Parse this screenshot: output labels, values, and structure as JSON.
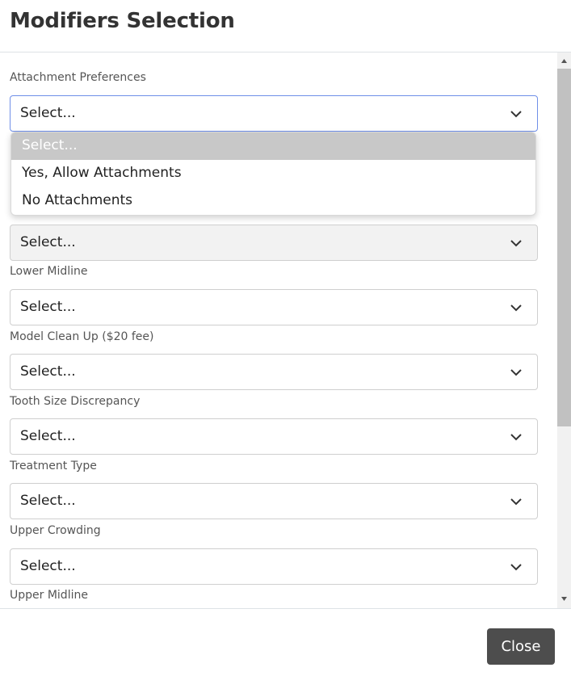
{
  "modal": {
    "title": "Modifiers Selection",
    "close_label": "Close"
  },
  "fields": [
    {
      "label": "Attachment Preferences",
      "value": "Select..."
    },
    {
      "label": "",
      "value": "Select..."
    },
    {
      "label": "Lower Midline",
      "value": "Select..."
    },
    {
      "label": "Model Clean Up ($20 fee)",
      "value": "Select..."
    },
    {
      "label": "Tooth Size Discrepancy",
      "value": "Select..."
    },
    {
      "label": "Treatment Type",
      "value": "Select..."
    },
    {
      "label": "Upper Crowding",
      "value": "Select..."
    },
    {
      "label": "Upper Midline",
      "value": ""
    }
  ],
  "dropdown": {
    "options": [
      "Select...",
      "Yes, Allow Attachments",
      "No Attachments"
    ],
    "selected_index": 0
  },
  "icons": {
    "select_chevron": "chevron-down-icon",
    "scroll_up": "scroll-up-arrow-icon",
    "scroll_down": "scroll-down-arrow-icon"
  },
  "colors": {
    "focus_border": "#6f8fe8",
    "selected_option_bg": "#c8c8c8",
    "close_button_bg": "#4d4d4d"
  }
}
